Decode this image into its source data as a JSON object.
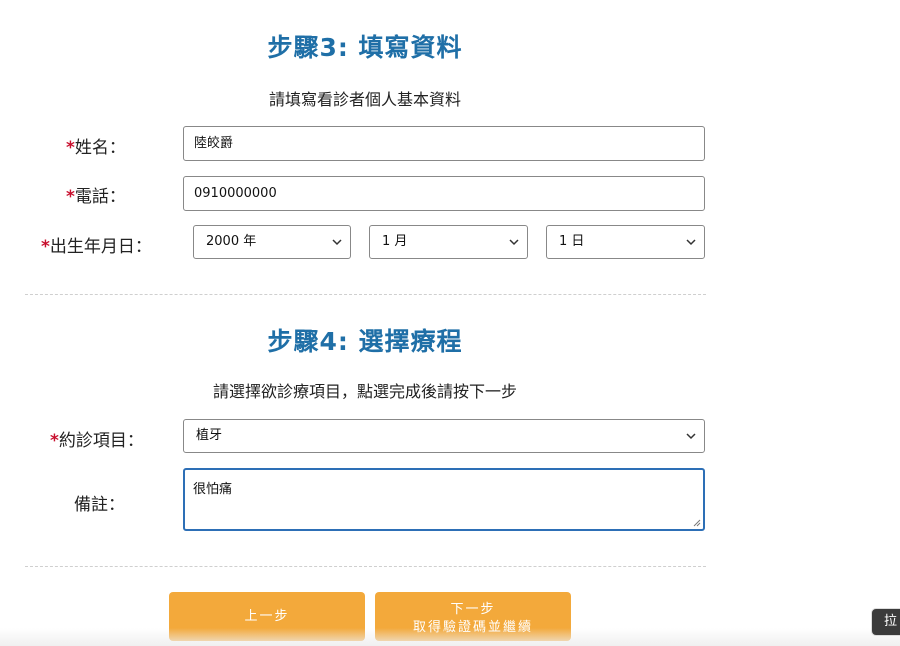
{
  "step3": {
    "title": "步驟3: 填寫資料",
    "subtitle": "請填寫看診者個人基本資料",
    "name": {
      "required_mark": "*",
      "label": "姓名：",
      "value": "陸皎爵"
    },
    "phone": {
      "required_mark": "*",
      "label": "電話：",
      "value": "0910000000"
    },
    "birthday": {
      "required_mark": "*",
      "label": "出生年月日：",
      "year": "2000 年",
      "month": "1 月",
      "day": "1 日"
    }
  },
  "step4": {
    "title": "步驟4: 選擇療程",
    "subtitle": "請選擇欲診療項目，點選完成後請按下一步",
    "item": {
      "required_mark": "*",
      "label": "約診項目：",
      "value": "植牙"
    },
    "note": {
      "label": "備註：",
      "value": "很怕痛"
    }
  },
  "buttons": {
    "prev": "上一步",
    "next_line1": "下一步",
    "next_line2": "取得驗證碼並繼續"
  },
  "side_tab": {
    "label": "拉"
  },
  "colors": {
    "title": "#1f6fa7",
    "required": "#c8102e",
    "button": "#f3a93b",
    "focus_border": "#2d6fb6"
  },
  "icons": {
    "select_arrow": "chevron-down-icon",
    "textarea_grip": "resize-grip-icon"
  }
}
